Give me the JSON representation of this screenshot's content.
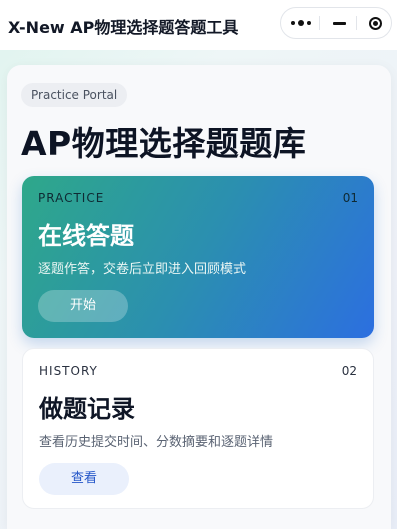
{
  "window": {
    "title": "X-New AP物理选择题答题工具"
  },
  "capsule": {
    "more_icon": "more-dots-icon",
    "minimize_icon": "minimize-icon",
    "close_icon": "close-circle-icon"
  },
  "main": {
    "badge": "Practice Portal",
    "title": "AP物理选择题题库",
    "cards": [
      {
        "tag": "PRACTICE",
        "num": "01",
        "title": "在线答题",
        "desc": "逐题作答，交卷后立即进入回顾模式",
        "button": "开始"
      },
      {
        "tag": "HISTORY",
        "num": "02",
        "title": "做题记录",
        "desc": "查看历史提交时间、分数摘要和逐题详情",
        "button": "查看"
      }
    ]
  },
  "colors": {
    "practice_gradient_start": "#2ea88a",
    "practice_gradient_end": "#2c6fe0",
    "history_button_text": "#2456c8",
    "title_text": "#0d1424"
  }
}
